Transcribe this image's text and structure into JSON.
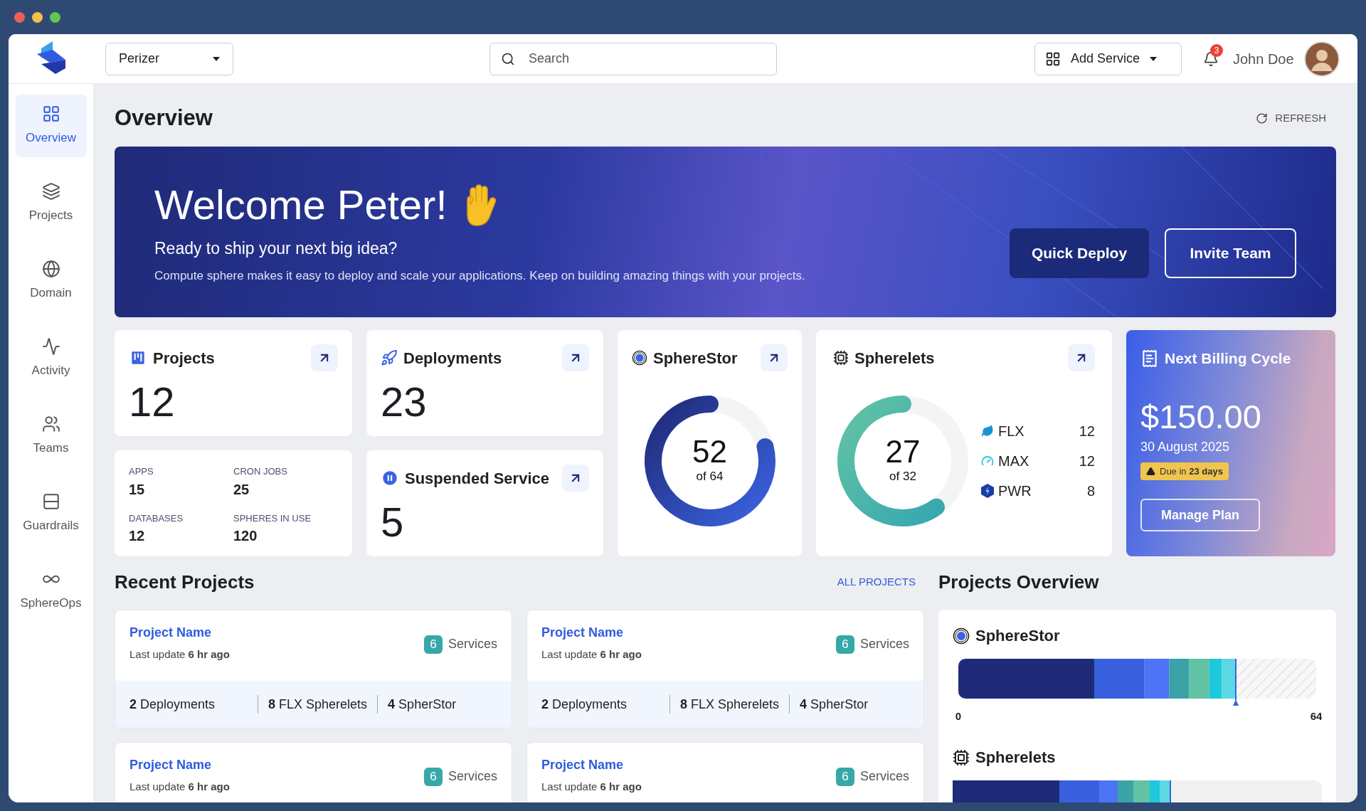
{
  "window": {
    "controls": [
      {
        "color": "#ec5f57"
      },
      {
        "color": "#f4be4f"
      },
      {
        "color": "#61c554"
      }
    ]
  },
  "header": {
    "workspace": "Perizer",
    "search": {
      "placeholder": "Search"
    },
    "add_service": "Add Service",
    "notifications": "3",
    "user": "John Doe"
  },
  "sidebar": {
    "items": [
      {
        "label": "Overview",
        "kind": "grid",
        "selected": true
      },
      {
        "label": "Projects",
        "kind": "layers",
        "selected": false
      },
      {
        "label": "Domain",
        "kind": "globe",
        "selected": false
      },
      {
        "label": "Activity",
        "kind": "activity",
        "selected": false
      },
      {
        "label": "Teams",
        "kind": "users",
        "selected": false
      },
      {
        "label": "Guardrails",
        "kind": "rows",
        "selected": false
      },
      {
        "label": "SphereOps",
        "kind": "infinity",
        "selected": false
      }
    ]
  },
  "page": {
    "title": "Overview",
    "refresh": "REFRESH"
  },
  "banner": {
    "title": "Welcome Peter!",
    "subtitle": "Ready to ship your next big idea?",
    "text": "Compute sphere makes it easy to deploy and scale your applications. Keep on building amazing things with your projects.",
    "buttons": [
      {
        "label": "Quick Deploy",
        "kind": "filled"
      },
      {
        "label": "Invite Team",
        "kind": "outline"
      }
    ]
  },
  "stats": {
    "projects": {
      "title": "Projects",
      "value": "12"
    },
    "deployments": {
      "title": "Deployments",
      "value": "23"
    },
    "breakdown": [
      {
        "label": "APPS",
        "value": "15"
      },
      {
        "label": "CRON JOBS",
        "value": "25"
      },
      {
        "label": "DATABASES",
        "value": "12"
      },
      {
        "label": "SPHERES IN USE",
        "value": "120"
      }
    ],
    "suspended": {
      "title": "Suspended Service",
      "value": "5"
    },
    "spherestor": {
      "title": "SphereStor",
      "value": "52",
      "total": "of 64"
    },
    "spherelets": {
      "title": "Spherelets",
      "value": "27",
      "total": "of 32",
      "legend": [
        {
          "kind": "leaf",
          "label": "FLX",
          "value": "12"
        },
        {
          "kind": "gauge",
          "label": "MAX",
          "value": "12"
        },
        {
          "kind": "bolt",
          "label": "PWR",
          "value": "8"
        }
      ]
    }
  },
  "billing": {
    "title": "Next Billing Cycle",
    "amount": "$150.00",
    "date": "30 August 2025",
    "due": "Due in **23 days**",
    "button": "Manage Plan"
  },
  "recent_projects": {
    "title": "Recent Projects",
    "link": "ALL PROJECTS",
    "items": [
      {
        "name": "Project Name",
        "update": "Last update **6 hr ago**",
        "count": "6",
        "count_label": "Services",
        "stats": [
          "**2** Deployments",
          "**8** FLX Spherelets",
          "**4** SpherStor"
        ]
      },
      {
        "name": "Project Name",
        "update": "Last update **6 hr ago**",
        "count": "6",
        "count_label": "Services",
        "stats": [
          "**2** Deployments",
          "**8** FLX Spherelets",
          "**4** SpherStor"
        ]
      },
      {
        "name": "Project Name",
        "update": "Last update **6 hr ago**",
        "count": "6",
        "count_label": "Services"
      },
      {
        "name": "Project Name",
        "update": "Last update **6 hr ago**",
        "count": "6",
        "count_label": "Services"
      }
    ]
  },
  "projects_overview": {
    "title": "Projects Overview",
    "groups": [
      {
        "kind": "stor",
        "chart_data": {
          "type": "bar",
          "title": "SphereStor",
          "orientation": "horizontal",
          "stacked": true,
          "xlim": [
            0,
            64
          ],
          "xticks": [
            0,
            64
          ],
          "series": [
            {
              "color": "#1f2a78",
              "values": [
                24.3
              ]
            },
            {
              "color": "#3860dc",
              "values": [
                9
              ]
            },
            {
              "color": "#4d74f5",
              "values": [
                4.4
              ]
            },
            {
              "color": "#3ba3a8",
              "values": [
                3.6
              ]
            },
            {
              "color": "#62c3a4",
              "values": [
                3.6
              ]
            },
            {
              "color": "#1ec8dc",
              "values": [
                2.2
              ]
            },
            {
              "color": "#5cd8e4",
              "values": [
                2.5
              ]
            }
          ]
        }
      },
      {
        "kind": "chip",
        "title": "Spherelets"
      }
    ]
  }
}
